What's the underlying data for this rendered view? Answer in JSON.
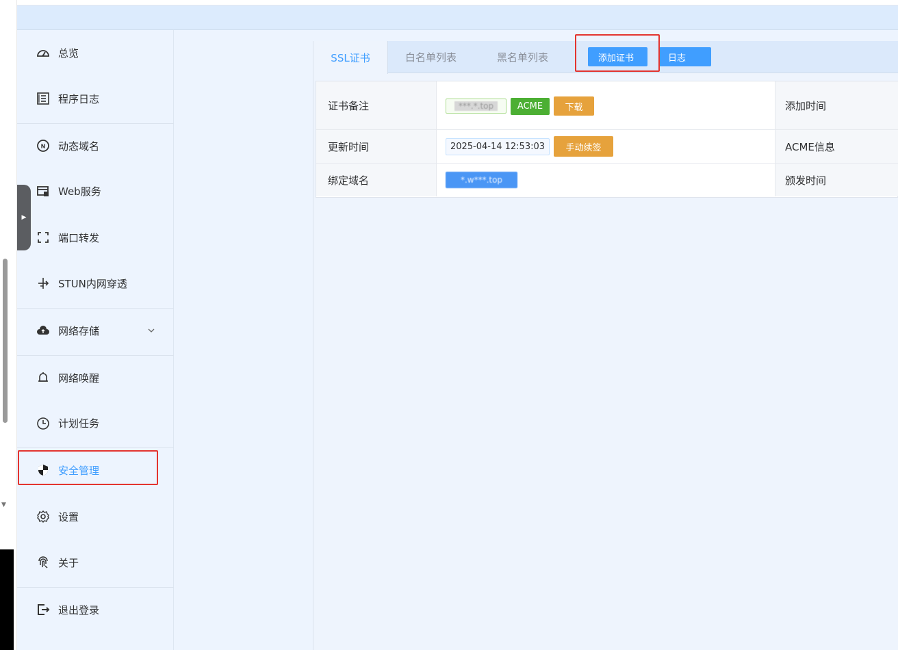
{
  "sidebar": {
    "items": [
      {
        "label": "总览",
        "icon": "dashboard-icon"
      },
      {
        "label": "程序日志",
        "icon": "log-icon"
      },
      {
        "label": "动态域名",
        "icon": "ddns-icon"
      },
      {
        "label": "Web服务",
        "icon": "web-service-icon"
      },
      {
        "label": "端口转发",
        "icon": "port-forward-icon"
      },
      {
        "label": "STUN内网穿透",
        "icon": "stun-icon"
      },
      {
        "label": "网络存储",
        "icon": "cloud-icon"
      },
      {
        "label": "网络唤醒",
        "icon": "bell-icon"
      },
      {
        "label": "计划任务",
        "icon": "clock-icon"
      },
      {
        "label": "安全管理",
        "icon": "shield-icon",
        "active": true
      },
      {
        "label": "设置",
        "icon": "gear-icon"
      },
      {
        "label": "关于",
        "icon": "fingerprint-icon"
      },
      {
        "label": "退出登录",
        "icon": "logout-icon"
      }
    ]
  },
  "tabs": [
    {
      "label": "SSL证书",
      "active": true
    },
    {
      "label": "白名单列表"
    },
    {
      "label": "黑名单列表"
    }
  ],
  "actions": {
    "add_cert": "添加证书",
    "log": "日志"
  },
  "cert": {
    "remark_label": "证书备注",
    "remark_value": "***.*.top",
    "type_tag": "ACME",
    "download": "下载",
    "add_time_label": "添加时间",
    "update_time_label": "更新时间",
    "update_time_value": "2025-04-14 12:53:03",
    "renew": "手动续签",
    "acme_info_label": "ACME信息",
    "domain_label": "绑定域名",
    "domain_value": "*.w***.top",
    "issue_time_label": "颁发时间"
  },
  "colors": {
    "primary": "#409eff",
    "success": "#4caf33",
    "warning": "#e6a23c",
    "highlight_box": "#e3342f",
    "sidebar_bg": "#edf4fe"
  }
}
